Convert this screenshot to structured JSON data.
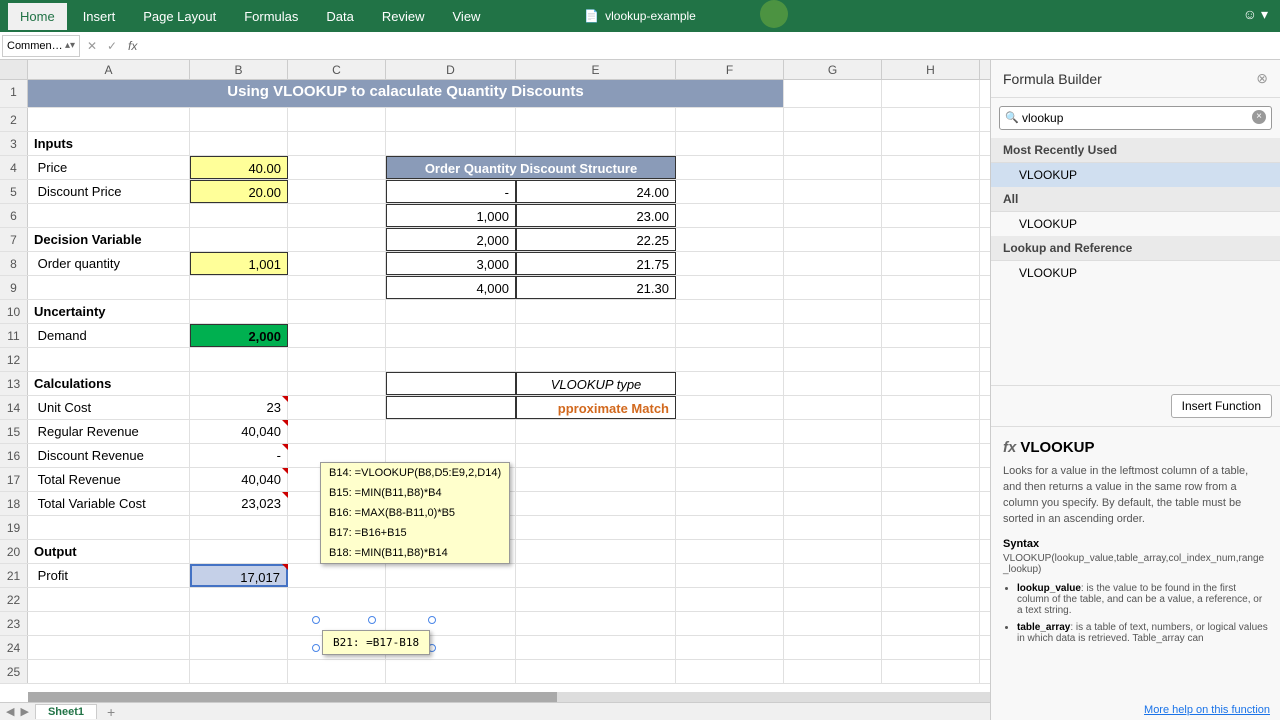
{
  "ribbon": {
    "tabs": [
      "Home",
      "Insert",
      "Page Layout",
      "Formulas",
      "Data",
      "Review",
      "View"
    ],
    "active": 0,
    "doc_title": "vlookup-example"
  },
  "nameBox": "Commen…",
  "colWidths": [
    "cA",
    "cB",
    "cC",
    "cD",
    "cE",
    "cF",
    "cG",
    "cH"
  ],
  "colLabels": [
    "A",
    "B",
    "C",
    "D",
    "E",
    "F",
    "G",
    "H"
  ],
  "sheet": {
    "title": "Using VLOOKUP to calaculate Quantity Discounts",
    "inputs_head": "Inputs",
    "price_lbl": "Price",
    "price_val": "40.00",
    "disc_price_lbl": "Discount Price",
    "disc_price_val": "20.00",
    "decvar_head": "Decision Variable",
    "orderq_lbl": "Order quantity",
    "orderq_val": "1,001",
    "uncertainty_head": "Uncertainty",
    "demand_lbl": "Demand",
    "demand_val": "2,000",
    "calc_head": "Calculations",
    "unitcost_lbl": "Unit Cost",
    "unitcost_val": "23",
    "regrev_lbl": "Regular Revenue",
    "regrev_val": "40,040",
    "discrev_lbl": "Discount Revenue",
    "discrev_val": "-",
    "totrev_lbl": "Total Revenue",
    "totrev_val": "40,040",
    "tvc_lbl": "Total Variable Cost",
    "tvc_val": "23,023",
    "output_head": "Output",
    "profit_lbl": "Profit",
    "profit_val": "17,017",
    "disc_struct_head": "Order Quantity Discount Structure",
    "disc_rows": [
      [
        "-",
        "24.00"
      ],
      [
        "1,000",
        "23.00"
      ],
      [
        "2,000",
        "22.25"
      ],
      [
        "3,000",
        "21.75"
      ],
      [
        "4,000",
        "21.30"
      ]
    ],
    "vlookup_type_lbl": "VLOOKUP type",
    "vlookup_type_val": "pproximate Match"
  },
  "callouts": {
    "b14": "B14: =VLOOKUP(B8,D5:E9,2,D14)",
    "b15": "B15: =MIN(B11,B8)*B4",
    "b16": "B16: =MAX(B8-B11,0)*B5",
    "b17": "B17: =B16+B15",
    "b18": "B18: =MIN(B11,B8)*B14",
    "b21": "B21: =B17-B18"
  },
  "panel": {
    "title": "Formula Builder",
    "search": "vlookup",
    "cats": [
      {
        "name": "Most Recently Used",
        "items": [
          "VLOOKUP"
        ],
        "sel": 0
      },
      {
        "name": "All",
        "items": [
          "VLOOKUP"
        ]
      },
      {
        "name": "Lookup and Reference",
        "items": [
          "VLOOKUP"
        ]
      }
    ],
    "insert_btn": "Insert Function",
    "fn": {
      "name": "VLOOKUP",
      "desc": "Looks for a value in the leftmost column of a table, and then returns a value in the same row from a column you specify. By default, the table must be sorted in an ascending order.",
      "syntax_h": "Syntax",
      "syntax": "VLOOKUP(lookup_value,table_array,col_index_num,range_lookup)",
      "args": [
        {
          "n": "lookup_value",
          "d": ": is the value to be found in the first column of the table, and can be a value, a reference, or a text string."
        },
        {
          "n": "table_array",
          "d": ": is a table of text, numbers, or logical values in which data is retrieved. Table_array can"
        }
      ],
      "more": "More help on this function"
    }
  },
  "sheetTab": "Sheet1"
}
